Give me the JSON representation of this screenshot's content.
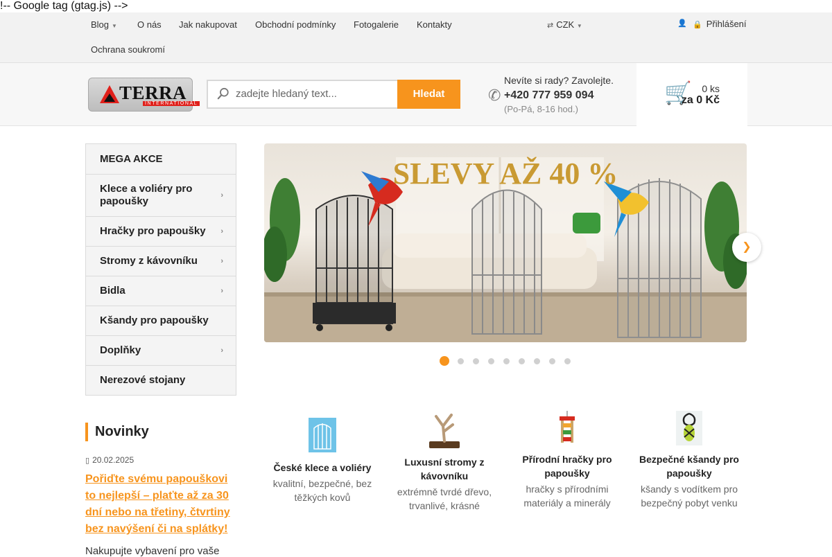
{
  "stray_text": "!-- Google tag (gtag.js) -->",
  "topnav": {
    "items": [
      {
        "label": "Blog",
        "has_caret": true
      },
      {
        "label": "O nás"
      },
      {
        "label": "Jak nakupovat"
      },
      {
        "label": "Obchodní podmínky"
      },
      {
        "label": "Fotogalerie"
      },
      {
        "label": "Kontakty"
      },
      {
        "label": "Ochrana soukromí"
      }
    ],
    "currency": "CZK",
    "login": "Přihlášení",
    "icons": {
      "currency": "exchange-icon",
      "user_menu": "user-icon",
      "login": "lock-icon"
    }
  },
  "header": {
    "logo_text": "TERRA",
    "logo_sub": "INTERNATIONAL",
    "search_placeholder": "zadejte hledaný text...",
    "search_button": "Hledat",
    "help_line1": "Nevíte si rady? Zavolejte.",
    "help_phone": "+420 777 959 094",
    "help_hours": "(Po-Pá, 8-16 hod.)",
    "cart_count": "0 ks",
    "cart_total": "za 0 Kč",
    "colors": {
      "accent": "#f7941d",
      "cart": "#3cb536",
      "brand_red": "#e0201b"
    }
  },
  "menu": {
    "items": [
      {
        "label": "MEGA AKCE",
        "has_sub": false
      },
      {
        "label": "Klece a voliéry pro papoušky",
        "has_sub": true
      },
      {
        "label": "Hračky pro papoušky",
        "has_sub": true
      },
      {
        "label": "Stromy z kávovníku",
        "has_sub": true
      },
      {
        "label": "Bidla",
        "has_sub": true
      },
      {
        "label": "Kšandy pro papoušky",
        "has_sub": false
      },
      {
        "label": "Doplňky",
        "has_sub": true
      },
      {
        "label": "Nerezové stojany",
        "has_sub": false
      }
    ]
  },
  "news": {
    "title": "Novinky",
    "date": "20.02.2025",
    "link": "Pořiďte svému papouškovi to nejlepší – plaťte až za 30 dní nebo na třetiny, čtvrtiny bez navýšení či na splátky!",
    "text": "Nakupujte vybavení pro vaše"
  },
  "banner": {
    "headline": "SLEVY AŽ 40 %",
    "slide_count": 9,
    "active_slide": 1
  },
  "features": [
    {
      "title": "České klece a voliéry",
      "desc": "kvalitní, bezpečné, bez těžkých kovů"
    },
    {
      "title": "Luxusní stromy z kávovníku",
      "desc": "extrémně tvrdé dřevo, trvanlivé, krásné"
    },
    {
      "title": "Přírodní hračky pro papoušky",
      "desc": "hračky s přírodními materiály a minerály"
    },
    {
      "title": "Bezpečné kšandy pro papoušky",
      "desc": "kšandy s vodítkem pro bezpečný pobyt venku"
    }
  ]
}
